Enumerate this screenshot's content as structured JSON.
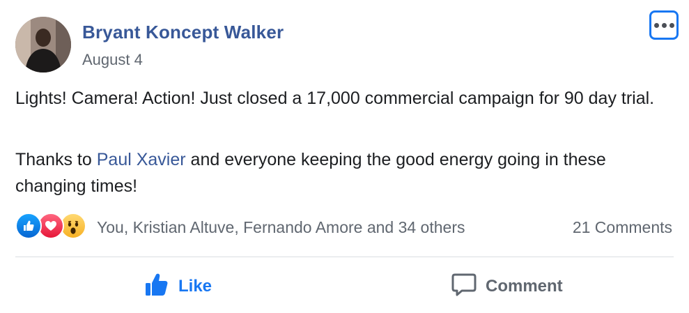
{
  "post": {
    "author": "Bryant Koncept Walker",
    "date": "August 4",
    "paragraphs": {
      "p1": "Lights! Camera! Action! Just closed a 17,000 commercial campaign for 90 day trial.",
      "p2_before": "Thanks to ",
      "p2_mention": "Paul Xavier",
      "p2_after": " and everyone keeping the good energy going in these changing times!"
    }
  },
  "reactions": {
    "icons": [
      "like-reaction-icon",
      "love-reaction-icon",
      "wow-reaction-icon"
    ],
    "summary": "You, Kristian Altuve, Fernando Amore and 34 others",
    "comments": "21 Comments"
  },
  "actions": {
    "like": "Like",
    "comment": "Comment"
  },
  "colors": {
    "author_link": "#385898",
    "like_active": "#1877f2",
    "secondary_text": "#606770",
    "focus_ring": "#1877f2"
  }
}
